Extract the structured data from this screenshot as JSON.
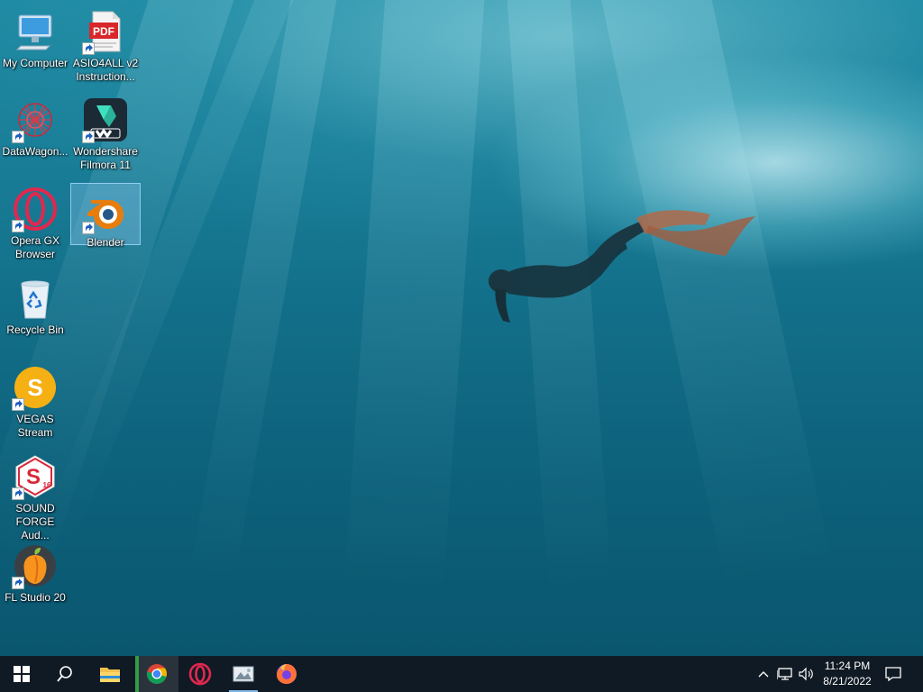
{
  "desktop": {
    "icons": [
      {
        "id": "my-computer",
        "label_line1": "My Computer",
        "label_line2": ""
      },
      {
        "id": "asio4all",
        "label_line1": "ASIO4ALL v2",
        "label_line2": "Instruction...",
        "badge": "PDF"
      },
      {
        "id": "datawagon",
        "label_line1": "DataWagon...",
        "label_line2": ""
      },
      {
        "id": "filmora",
        "label_line1": "Wondershare",
        "label_line2": "Filmora 11"
      },
      {
        "id": "opera-gx",
        "label_line1": "Opera GX",
        "label_line2": "Browser"
      },
      {
        "id": "blender",
        "label_line1": "Blender",
        "label_line2": "",
        "selected": true
      },
      {
        "id": "recycle-bin",
        "label_line1": "Recycle Bin",
        "label_line2": ""
      },
      {
        "id": "vegas-stream",
        "label_line1": "VEGAS",
        "label_line2": "Stream",
        "badge": "S"
      },
      {
        "id": "sound-forge",
        "label_line1": "SOUND",
        "label_line2": "FORGE Aud...",
        "badge": "S",
        "sub_badge": "16"
      },
      {
        "id": "fl-studio",
        "label_line1": "FL Studio 20",
        "label_line2": ""
      }
    ]
  },
  "taskbar": {
    "pinned": [
      "start-menu",
      "search",
      "file-explorer",
      "chrome",
      "opera",
      "media-app",
      "firefox"
    ],
    "active_app": "chrome",
    "clock": {
      "time": "11:24 PM",
      "date": "8/21/2022"
    }
  },
  "colors": {
    "taskbar_bg": "#101a24",
    "accent": "#7fb8e6",
    "wallpaper_top": "#1f8aa3",
    "wallpaper_bottom": "#0a566f"
  }
}
